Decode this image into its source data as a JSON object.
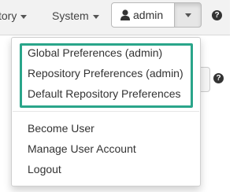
{
  "navbar": {
    "repository_label": "tory",
    "system_label": "System",
    "user_label": "admin"
  },
  "user_menu": {
    "items": [
      {
        "label": "Global Preferences (admin)"
      },
      {
        "label": "Repository Preferences (admin)"
      },
      {
        "label": "Default Repository Preferences"
      },
      {
        "label": "Become User"
      },
      {
        "label": "Manage User Account"
      },
      {
        "label": "Logout"
      }
    ],
    "highlight_color": "#2aa58a"
  },
  "icons": {
    "user": "user-icon",
    "caret": "caret-down-icon",
    "help": "question-circle-icon"
  },
  "help_glyph": "?"
}
